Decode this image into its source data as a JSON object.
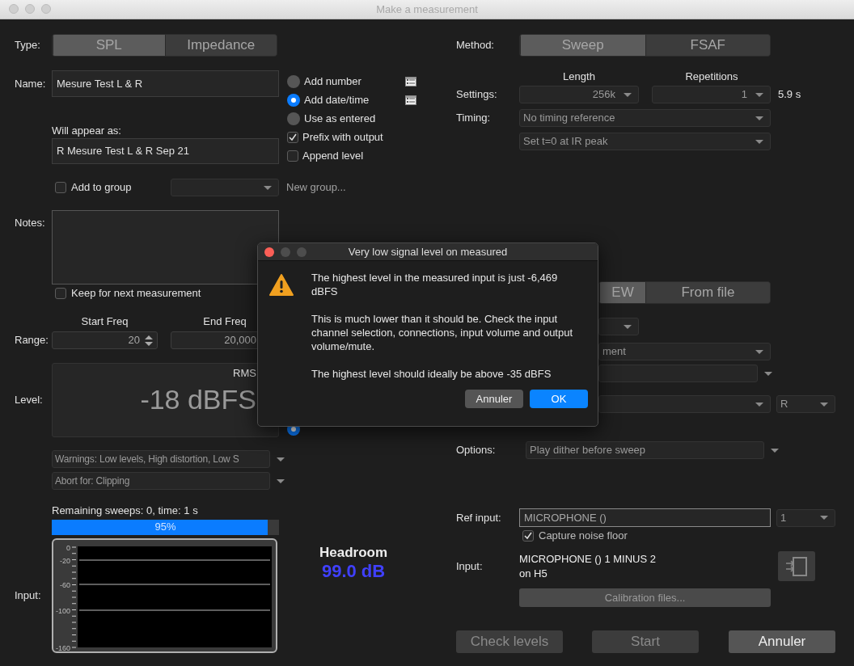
{
  "window": {
    "title": "Make a measurement"
  },
  "type": {
    "label": "Type:",
    "options": [
      {
        "label": "SPL",
        "selected": true
      },
      {
        "label": "Impedance",
        "selected": false
      }
    ]
  },
  "name": {
    "label": "Name:",
    "value": "Mesure Test L & R"
  },
  "naming_options": [
    {
      "kind": "radio",
      "label": "Add number",
      "selected": false,
      "list_button": true
    },
    {
      "kind": "radio",
      "label": "Add date/time",
      "selected": true,
      "list_button": true
    },
    {
      "kind": "radio",
      "label": "Use as entered",
      "selected": false,
      "list_button": false
    },
    {
      "kind": "checkbox",
      "label": "Prefix with output",
      "checked": true,
      "list_button": false
    },
    {
      "kind": "checkbox",
      "label": "Append level",
      "checked": false,
      "list_button": false
    }
  ],
  "will_appear": {
    "label": "Will appear as:",
    "value": "R Mesure Test L & R Sep 21"
  },
  "group": {
    "label": "Add to group",
    "checked": false,
    "new_group": "New group..."
  },
  "notes": {
    "label": "Notes:",
    "keep_label": "Keep for next measurement",
    "keep_checked": false
  },
  "range": {
    "label": "Range:",
    "start_label": "Start Freq",
    "start_value": "20",
    "end_label": "End Freq",
    "end_value": "20,000"
  },
  "level": {
    "label": "Level:",
    "mode": "RMS",
    "reading": "-18 dBFS",
    "unit": {
      "selected": true
    }
  },
  "warnings": "Warnings: Low levels, High distortion, Low S",
  "abort": "Abort for: Clipping",
  "progress": {
    "status": "Remaining sweeps: 0, time: 1 s",
    "level": 0.95,
    "label": "95%"
  },
  "input_meter": {
    "label": "Input:",
    "scale": [
      "0",
      "-20",
      "-60",
      "-100",
      "-160"
    ]
  },
  "headroom": {
    "label": "Headroom",
    "value": "99.0 dB"
  },
  "method": {
    "label": "Method:",
    "options": [
      {
        "label": "Sweep",
        "selected": true
      },
      {
        "label": "FSAF",
        "selected": false
      }
    ]
  },
  "settings": {
    "label": "Settings:",
    "length_label": "Length",
    "length": "256k",
    "repetitions_label": "Repetitions",
    "repetitions": "1",
    "duration": "5.9 s"
  },
  "timing": {
    "label": "Timing:",
    "reference": "No timing reference",
    "ir": "Set t=0 at IR peak"
  },
  "source": {
    "options": [
      {
        "label": "EW",
        "selected": true
      },
      {
        "label": "From file",
        "selected": false
      }
    ],
    "mode_fragment": "ment",
    "channel": "R"
  },
  "options": {
    "label": "Options:",
    "value": "Play dither before sweep"
  },
  "ref_input": {
    "label": "Ref input:",
    "value": "MICROPHONE ()",
    "channel": "1",
    "capture_label": "Capture noise floor",
    "capture_checked": true
  },
  "input": {
    "label": "Input:",
    "lines": [
      "MICROPHONE () 1 MINUS 2",
      "on H5"
    ]
  },
  "calibration": "Calibration files...",
  "buttons": [
    {
      "label": "Check levels",
      "disabled": true
    },
    {
      "label": "Start",
      "disabled": true
    },
    {
      "label": "Annuler",
      "disabled": false
    }
  ],
  "dialog": {
    "title": "Very low signal level on measured",
    "paragraphs": [
      "The highest level in the measured input is just -6,469 dBFS",
      "This is much lower than it should be. Check the input channel selection, connections, input volume and output volume/mute.",
      "The highest level should ideally be above -35 dBFS"
    ],
    "buttons": [
      {
        "label": "Annuler",
        "default": false
      },
      {
        "label": "OK",
        "default": true
      }
    ]
  }
}
